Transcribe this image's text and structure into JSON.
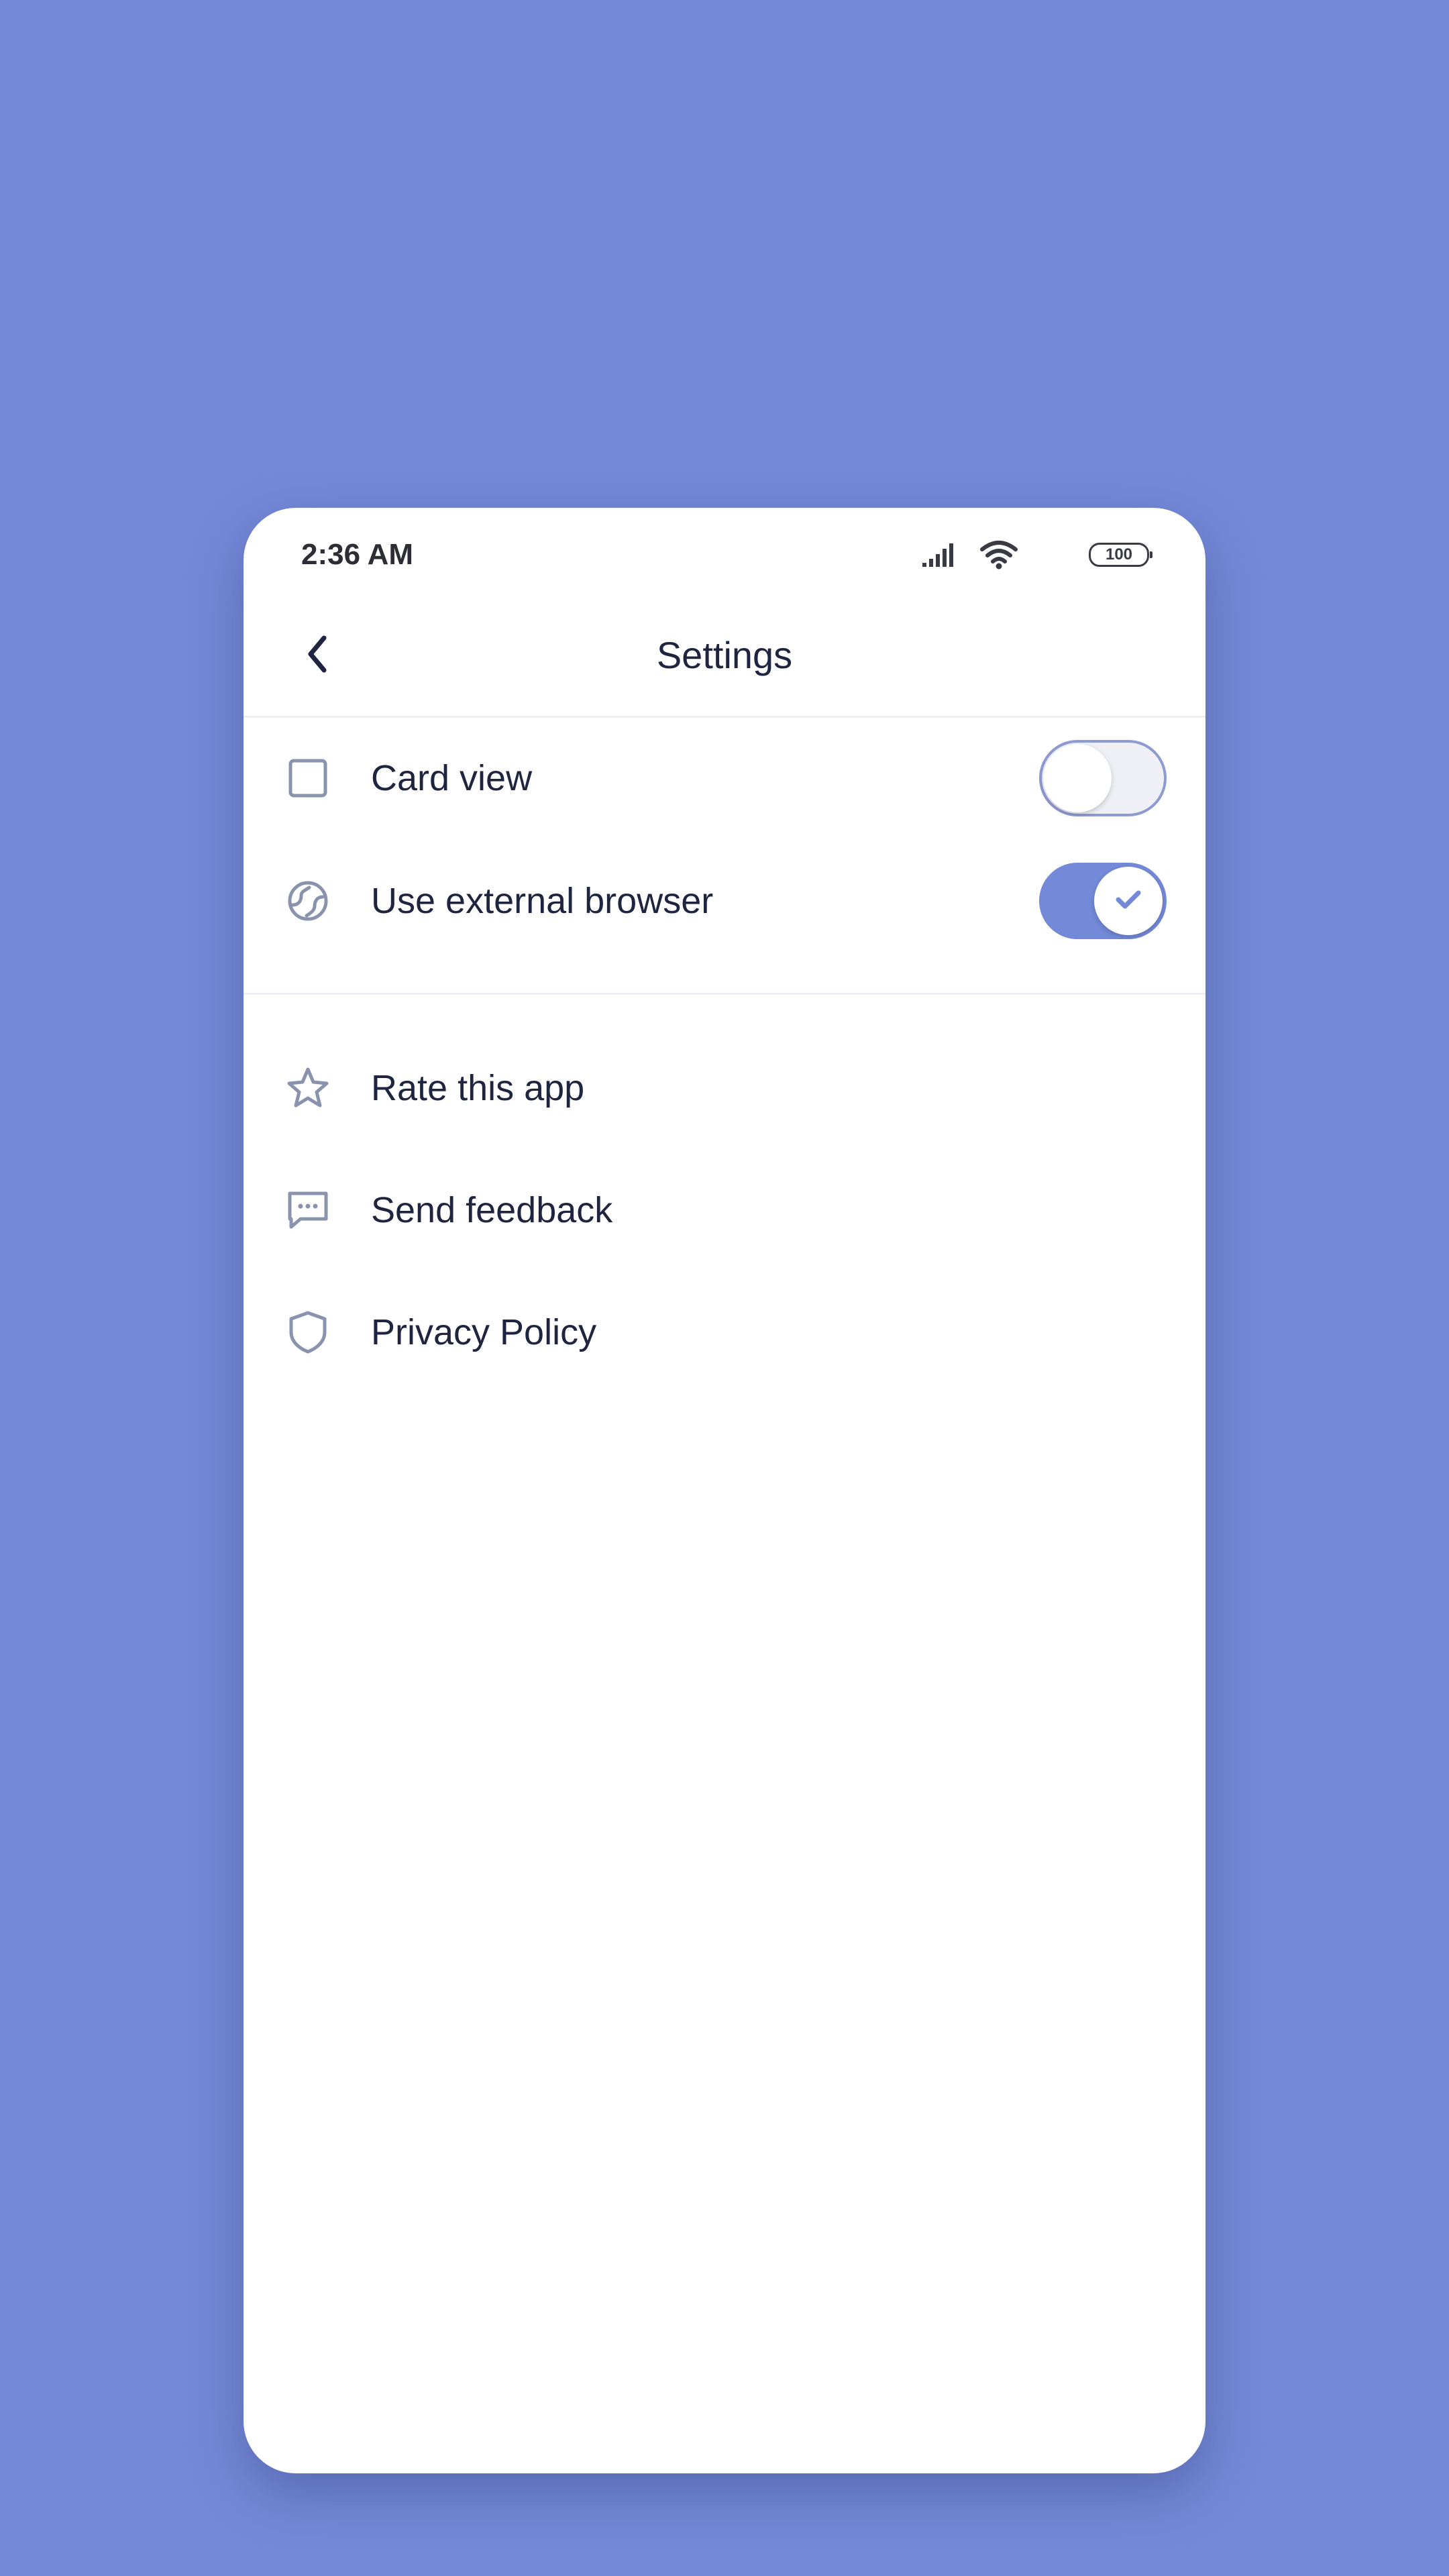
{
  "status_bar": {
    "time": "2:36 AM",
    "battery_level": "100",
    "icons": [
      "signal-icon",
      "wifi-icon",
      "battery-icon"
    ]
  },
  "app_bar": {
    "title": "Settings",
    "back_icon": "chevron-left-icon"
  },
  "settings": {
    "toggles": [
      {
        "label": "Card view",
        "icon": "square-icon",
        "enabled": false
      },
      {
        "label": "Use external browser",
        "icon": "globe-icon",
        "enabled": true
      }
    ],
    "links": [
      {
        "label": "Rate this app",
        "icon": "star-icon"
      },
      {
        "label": "Send feedback",
        "icon": "chat-icon"
      },
      {
        "label": "Privacy Policy",
        "icon": "shield-icon"
      }
    ]
  },
  "colors": {
    "background": "#7489d8",
    "accent": "#7489d8",
    "icon": "#8a93ad",
    "text": "#1f2540"
  }
}
